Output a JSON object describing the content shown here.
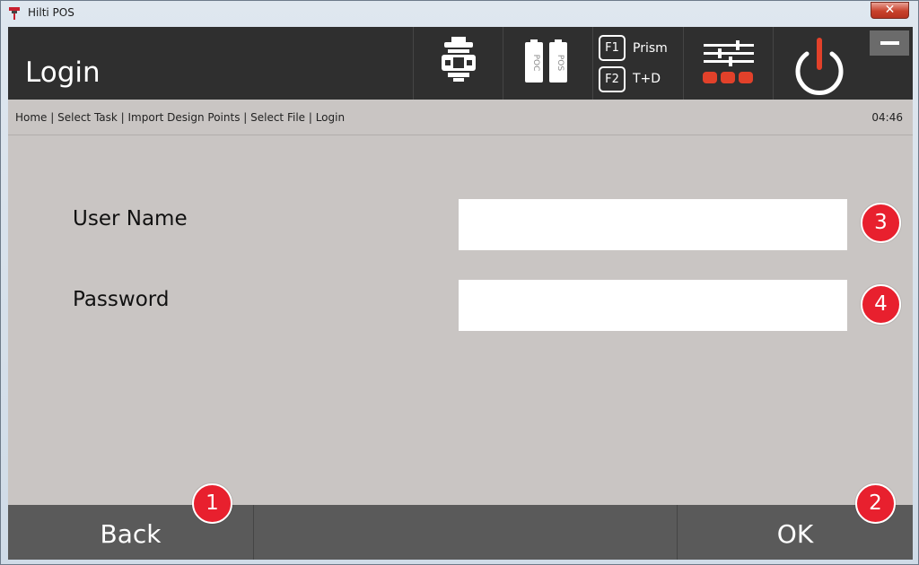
{
  "window": {
    "title": "Hilti POS",
    "close_glyph": "✕"
  },
  "header": {
    "title": "Login",
    "buttons": [
      {
        "name": "instrument-icon"
      },
      {
        "name": "battery-icon",
        "label_left": "POC",
        "label_right": "POS"
      },
      {
        "name": "target-mode",
        "f1_key": "F1",
        "f1_label": "Prism",
        "f2_key": "F2",
        "f2_label": "T+D"
      },
      {
        "name": "settings-sliders-icon"
      },
      {
        "name": "power-icon"
      }
    ],
    "accent_color": "#e2412a"
  },
  "breadcrumb": {
    "path": "Home | Select Task | Import Design Points | Select File | Login",
    "time": "04:46"
  },
  "form": {
    "user_name_label": "User Name",
    "user_name_value": "",
    "password_label": "Password",
    "password_value": ""
  },
  "callouts": {
    "c1": "1",
    "c2": "2",
    "c3": "3",
    "c4": "4",
    "color": "#e8202e"
  },
  "bottom_bar": {
    "back_label": "Back",
    "ok_label": "OK"
  }
}
